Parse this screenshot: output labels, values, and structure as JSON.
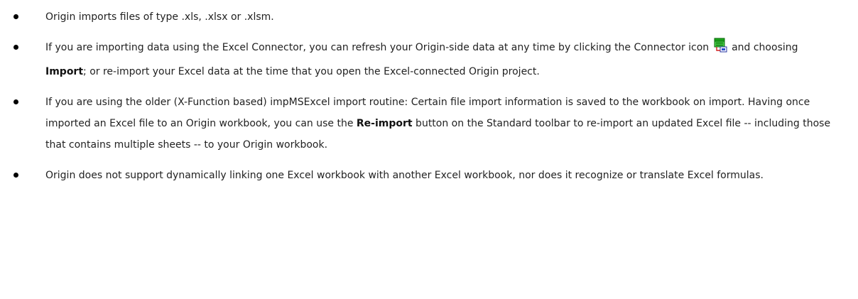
{
  "bullets": [
    {
      "text": "Origin imports files of type .xls, .xlsx or .xlsm."
    },
    {
      "text_before_icon": "If you are importing data using the Excel Connector, you can refresh your Origin-side data at any time by clicking the Connector icon ",
      "icon": "connector-icon",
      "text_after_icon": " and choosing ",
      "bold": "Import",
      "text_end": "; or re-import your Excel data at the time that you open the Excel-connected Origin project."
    },
    {
      "text_before_bold": "If you are using the older (X-Function based) impMSExcel import routine: Certain file import information is saved to the workbook on import. Having once imported an Excel file to an Origin workbook, you can use the ",
      "bold": "Re-import",
      "text_after_bold": " button on the Standard toolbar to re-import an updated Excel file -- including those that contains multiple sheets -- to your Origin workbook."
    },
    {
      "text": "Origin does not support dynamically linking one Excel workbook with another Excel workbook, nor does it recognize or translate Excel formulas."
    }
  ]
}
